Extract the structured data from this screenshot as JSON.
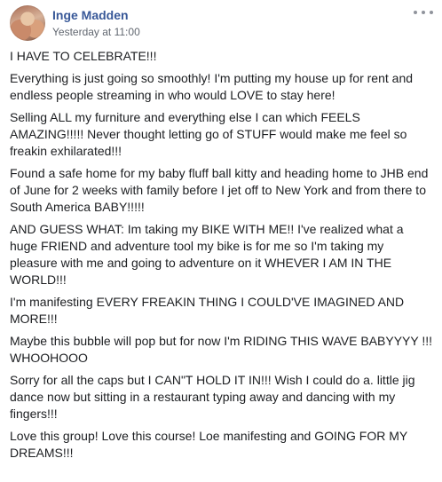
{
  "post": {
    "author": "Inge Madden",
    "timestamp": "Yesterday at 11:00",
    "more_icon": "more-horizontal-icon",
    "paragraphs": [
      "I HAVE TO CELEBRATE!!!",
      "Everything is just going so smoothly! I'm putting my house up for rent and endless people streaming in who would LOVE to stay here!",
      "Selling ALL my furniture and everything else I can which FEELS AMAZING!!!!! Never thought letting go of STUFF would make me feel so freakin exhilarated!!!",
      "Found a safe home for my baby fluff ball kitty and heading home to JHB end of June for 2 weeks with family before I jet off to New York and from there to South America BABY!!!!!",
      "AND GUESS WHAT: Im taking my BIKE WITH ME!! I've realized what a huge FRIEND and adventure tool my bike is for me so I'm taking my pleasure with me and going to adventure on it WHEVER I AM IN THE WORLD!!!",
      "I'm manifesting EVERY FREAKIN THING I COULD'VE IMAGINED AND MORE!!!",
      "Maybe this bubble will pop but for now I'm RIDING THIS WAVE BABYYYY !!! WHOOHOOO",
      "Sorry for all the caps but I CAN\"T HOLD IT IN!!! Wish I could do a. little jig dance now but sitting in a restaurant typing away and dancing with my fingers!!!",
      "Love this group! Love this course! Loe manifesting and GOING FOR MY DREAMS!!!"
    ]
  },
  "colors": {
    "author_link": "#385898",
    "meta_text": "#616770",
    "body_text": "#1c1e21",
    "icon": "#90949c"
  }
}
